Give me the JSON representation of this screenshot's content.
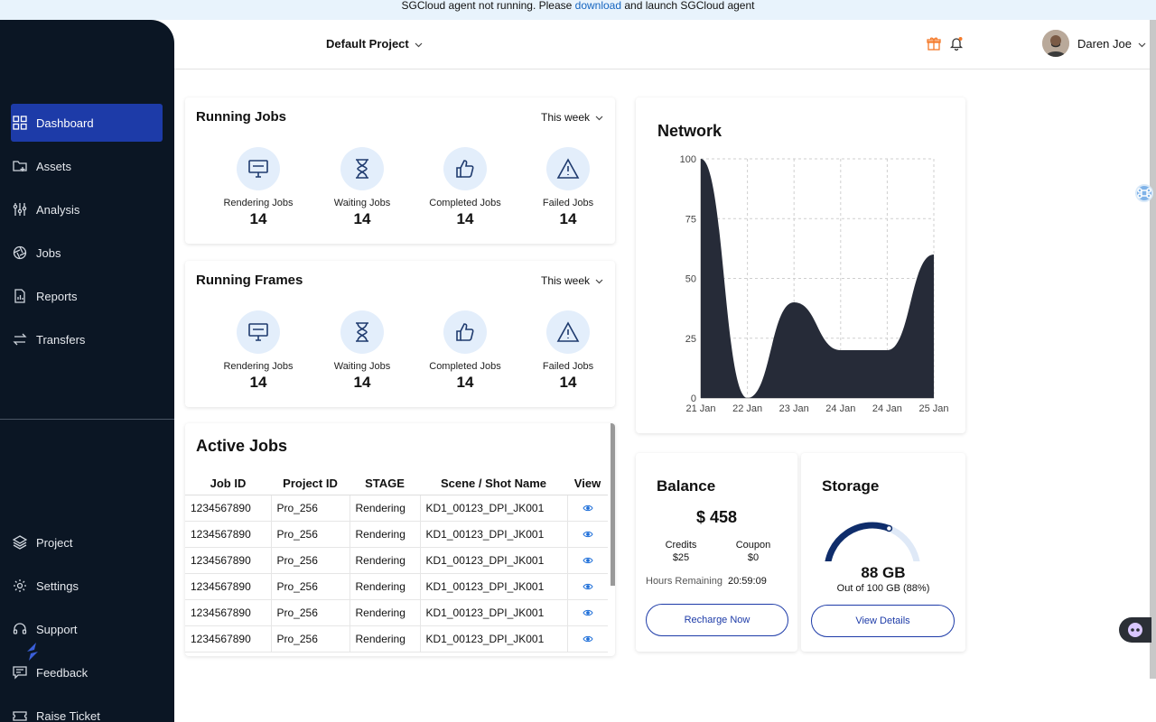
{
  "banner": {
    "prefix": "SGCloud agent not running. Please",
    "link": "download",
    "suffix": "and launch SGCloud agent"
  },
  "sidebar": {
    "items": [
      {
        "label": "Dashboard",
        "icon": "grid-icon",
        "active": true
      },
      {
        "label": "Assets",
        "icon": "folder-icon"
      },
      {
        "label": "Analysis",
        "icon": "sliders-icon"
      },
      {
        "label": "Jobs",
        "icon": "aperture-icon"
      },
      {
        "label": "Reports",
        "icon": "report-icon"
      },
      {
        "label": "Transfers",
        "icon": "transfer-icon"
      }
    ],
    "bottom_items": [
      {
        "label": "Project",
        "icon": "layers-icon"
      },
      {
        "label": "Settings",
        "icon": "gear-icon"
      },
      {
        "label": "Support",
        "icon": "headset-icon"
      },
      {
        "label": "Feedback",
        "icon": "feedback-icon"
      },
      {
        "label": "Raise Ticket",
        "icon": "ticket-icon"
      }
    ]
  },
  "header": {
    "project": "Default Project",
    "user_name": "Daren Joe",
    "accent": "#f47a2a"
  },
  "running_jobs": {
    "title": "Running Jobs",
    "period": "This week",
    "stats": [
      {
        "label": "Rendering Jobs",
        "value": "14",
        "icon": "monitor-icon"
      },
      {
        "label": "Waiting Jobs",
        "value": "14",
        "icon": "hourglass-icon"
      },
      {
        "label": "Completed Jobs",
        "value": "14",
        "icon": "thumbs-up-icon"
      },
      {
        "label": "Failed Jobs",
        "value": "14",
        "icon": "warning-icon"
      }
    ]
  },
  "running_frames": {
    "title": "Running Frames",
    "period": "This week",
    "stats": [
      {
        "label": "Rendering Jobs",
        "value": "14",
        "icon": "monitor-icon"
      },
      {
        "label": "Waiting Jobs",
        "value": "14",
        "icon": "hourglass-icon"
      },
      {
        "label": "Completed Jobs",
        "value": "14",
        "icon": "thumbs-up-icon"
      },
      {
        "label": "Failed Jobs",
        "value": "14",
        "icon": "warning-icon"
      }
    ]
  },
  "active_jobs": {
    "title": "Active Jobs",
    "columns": [
      "Job ID",
      "Project ID",
      "STAGE",
      "Scene / Shot Name",
      "View"
    ],
    "rows": [
      [
        "1234567890",
        "Pro_256",
        "Rendering",
        "KD1_00123_DPI_JK001"
      ],
      [
        "1234567890",
        "Pro_256",
        "Rendering",
        "KD1_00123_DPI_JK001"
      ],
      [
        "1234567890",
        "Pro_256",
        "Rendering",
        "KD1_00123_DPI_JK001"
      ],
      [
        "1234567890",
        "Pro_256",
        "Rendering",
        "KD1_00123_DPI_JK001"
      ],
      [
        "1234567890",
        "Pro_256",
        "Rendering",
        "KD1_00123_DPI_JK001"
      ],
      [
        "1234567890",
        "Pro_256",
        "Rendering",
        "KD1_00123_DPI_JK001"
      ]
    ]
  },
  "network": {
    "title": "Network",
    "chart_data": {
      "type": "area",
      "categories": [
        "21 Jan",
        "22 Jan",
        "23 Jan",
        "24 Jan",
        "24 Jan",
        "25 Jan"
      ],
      "values": [
        100,
        0,
        40,
        20,
        20,
        60
      ],
      "ylim": [
        0,
        100
      ],
      "yticks": [
        0,
        25,
        50,
        75,
        100
      ],
      "grid": true,
      "fill_color": "#262b38"
    }
  },
  "balance": {
    "title": "Balance",
    "amount": "$ 458",
    "credits_label": "Credits",
    "credits_value": "$25",
    "coupon_label": "Coupon",
    "coupon_value": "$0",
    "hours_label": "Hours Remaining",
    "hours_value": "20:59:09",
    "button": "Recharge Now"
  },
  "storage": {
    "title": "Storage",
    "used": "88 GB",
    "detail": "Out of 100 GB (88%)",
    "fraction": 0.88,
    "button": "View Details"
  }
}
